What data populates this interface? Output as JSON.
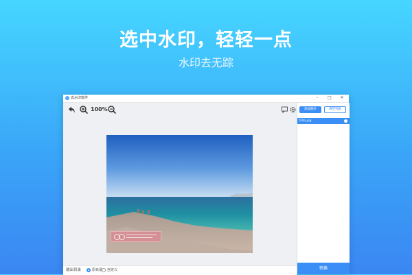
{
  "hero": {
    "title": "选中水印，轻轻一点",
    "subtitle": "水印去无踪"
  },
  "app": {
    "title": "去水印软件",
    "window_controls": [
      "–",
      "□",
      "✕"
    ],
    "toolbar": {
      "zoom_level": "100%",
      "icons": [
        "undo-icon",
        "zoom-in-icon",
        "zoom-out-icon",
        "comment-icon",
        "settings-icon"
      ]
    },
    "bottom": {
      "output_label": "输出目录",
      "option_original": "原目录",
      "option_custom": "自定义",
      "selected": "original"
    },
    "side": {
      "add_button": "添加图片",
      "clear_button": "清空列表",
      "files": [
        {
          "name": "5f4a.jpg"
        }
      ],
      "convert_button": "转换"
    }
  },
  "colors": {
    "accent": "#3a8ef5",
    "bg_gradient_top": "#46d6ff",
    "bg_gradient_bottom": "#3b86f2",
    "main_area_bg": "#eef0f3"
  }
}
